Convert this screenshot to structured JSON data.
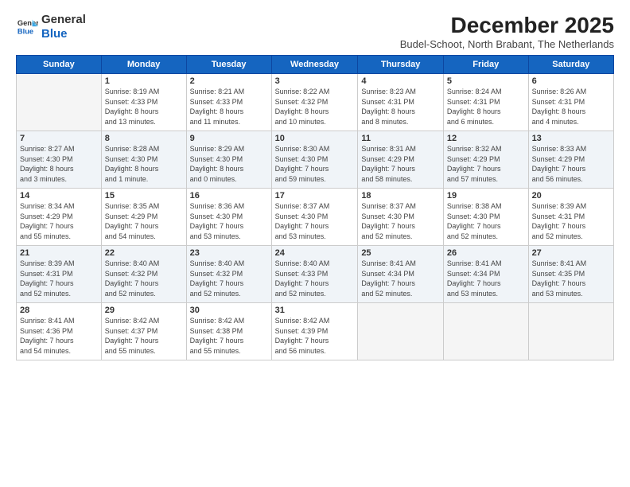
{
  "header": {
    "logo_general": "General",
    "logo_blue": "Blue",
    "month_year": "December 2025",
    "location": "Budel-Schoot, North Brabant, The Netherlands"
  },
  "weekdays": [
    "Sunday",
    "Monday",
    "Tuesday",
    "Wednesday",
    "Thursday",
    "Friday",
    "Saturday"
  ],
  "weeks": [
    [
      {
        "day": "",
        "info": ""
      },
      {
        "day": "1",
        "info": "Sunrise: 8:19 AM\nSunset: 4:33 PM\nDaylight: 8 hours\nand 13 minutes."
      },
      {
        "day": "2",
        "info": "Sunrise: 8:21 AM\nSunset: 4:33 PM\nDaylight: 8 hours\nand 11 minutes."
      },
      {
        "day": "3",
        "info": "Sunrise: 8:22 AM\nSunset: 4:32 PM\nDaylight: 8 hours\nand 10 minutes."
      },
      {
        "day": "4",
        "info": "Sunrise: 8:23 AM\nSunset: 4:31 PM\nDaylight: 8 hours\nand 8 minutes."
      },
      {
        "day": "5",
        "info": "Sunrise: 8:24 AM\nSunset: 4:31 PM\nDaylight: 8 hours\nand 6 minutes."
      },
      {
        "day": "6",
        "info": "Sunrise: 8:26 AM\nSunset: 4:31 PM\nDaylight: 8 hours\nand 4 minutes."
      }
    ],
    [
      {
        "day": "7",
        "info": "Sunrise: 8:27 AM\nSunset: 4:30 PM\nDaylight: 8 hours\nand 3 minutes."
      },
      {
        "day": "8",
        "info": "Sunrise: 8:28 AM\nSunset: 4:30 PM\nDaylight: 8 hours\nand 1 minute."
      },
      {
        "day": "9",
        "info": "Sunrise: 8:29 AM\nSunset: 4:30 PM\nDaylight: 8 hours\nand 0 minutes."
      },
      {
        "day": "10",
        "info": "Sunrise: 8:30 AM\nSunset: 4:30 PM\nDaylight: 7 hours\nand 59 minutes."
      },
      {
        "day": "11",
        "info": "Sunrise: 8:31 AM\nSunset: 4:29 PM\nDaylight: 7 hours\nand 58 minutes."
      },
      {
        "day": "12",
        "info": "Sunrise: 8:32 AM\nSunset: 4:29 PM\nDaylight: 7 hours\nand 57 minutes."
      },
      {
        "day": "13",
        "info": "Sunrise: 8:33 AM\nSunset: 4:29 PM\nDaylight: 7 hours\nand 56 minutes."
      }
    ],
    [
      {
        "day": "14",
        "info": "Sunrise: 8:34 AM\nSunset: 4:29 PM\nDaylight: 7 hours\nand 55 minutes."
      },
      {
        "day": "15",
        "info": "Sunrise: 8:35 AM\nSunset: 4:29 PM\nDaylight: 7 hours\nand 54 minutes."
      },
      {
        "day": "16",
        "info": "Sunrise: 8:36 AM\nSunset: 4:30 PM\nDaylight: 7 hours\nand 53 minutes."
      },
      {
        "day": "17",
        "info": "Sunrise: 8:37 AM\nSunset: 4:30 PM\nDaylight: 7 hours\nand 53 minutes."
      },
      {
        "day": "18",
        "info": "Sunrise: 8:37 AM\nSunset: 4:30 PM\nDaylight: 7 hours\nand 52 minutes."
      },
      {
        "day": "19",
        "info": "Sunrise: 8:38 AM\nSunset: 4:30 PM\nDaylight: 7 hours\nand 52 minutes."
      },
      {
        "day": "20",
        "info": "Sunrise: 8:39 AM\nSunset: 4:31 PM\nDaylight: 7 hours\nand 52 minutes."
      }
    ],
    [
      {
        "day": "21",
        "info": "Sunrise: 8:39 AM\nSunset: 4:31 PM\nDaylight: 7 hours\nand 52 minutes."
      },
      {
        "day": "22",
        "info": "Sunrise: 8:40 AM\nSunset: 4:32 PM\nDaylight: 7 hours\nand 52 minutes."
      },
      {
        "day": "23",
        "info": "Sunrise: 8:40 AM\nSunset: 4:32 PM\nDaylight: 7 hours\nand 52 minutes."
      },
      {
        "day": "24",
        "info": "Sunrise: 8:40 AM\nSunset: 4:33 PM\nDaylight: 7 hours\nand 52 minutes."
      },
      {
        "day": "25",
        "info": "Sunrise: 8:41 AM\nSunset: 4:34 PM\nDaylight: 7 hours\nand 52 minutes."
      },
      {
        "day": "26",
        "info": "Sunrise: 8:41 AM\nSunset: 4:34 PM\nDaylight: 7 hours\nand 53 minutes."
      },
      {
        "day": "27",
        "info": "Sunrise: 8:41 AM\nSunset: 4:35 PM\nDaylight: 7 hours\nand 53 minutes."
      }
    ],
    [
      {
        "day": "28",
        "info": "Sunrise: 8:41 AM\nSunset: 4:36 PM\nDaylight: 7 hours\nand 54 minutes."
      },
      {
        "day": "29",
        "info": "Sunrise: 8:42 AM\nSunset: 4:37 PM\nDaylight: 7 hours\nand 55 minutes."
      },
      {
        "day": "30",
        "info": "Sunrise: 8:42 AM\nSunset: 4:38 PM\nDaylight: 7 hours\nand 55 minutes."
      },
      {
        "day": "31",
        "info": "Sunrise: 8:42 AM\nSunset: 4:39 PM\nDaylight: 7 hours\nand 56 minutes."
      },
      {
        "day": "",
        "info": ""
      },
      {
        "day": "",
        "info": ""
      },
      {
        "day": "",
        "info": ""
      }
    ]
  ]
}
